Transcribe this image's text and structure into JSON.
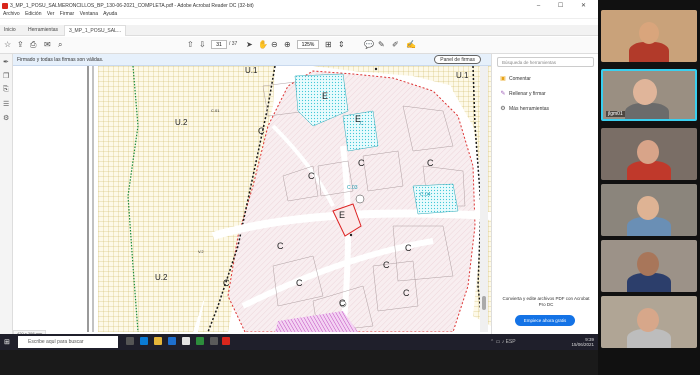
{
  "window": {
    "title": "3_MP_1_POSU_SALMERONCILLOS_BP_130-06-2021_COMPLETA.pdf - Adobe Acrobat Reader DC (32-bit)",
    "menus": [
      "Archivo",
      "Edición",
      "Ver",
      "Firmar",
      "Ventana",
      "Ayuda"
    ],
    "controls": "–  ☐  ✕"
  },
  "tabs": [
    {
      "label": "Inicio"
    },
    {
      "label": "Herramientas"
    },
    {
      "label": "3_MP_1_POSU_SAL..."
    }
  ],
  "toolbar": {
    "page_current": "31",
    "page_total": "/ 37",
    "zoom": "125%"
  },
  "signature_bar": {
    "message": "Firmado y todas las firmas son válidas.",
    "button": "Panel de firmas"
  },
  "right_panel": {
    "search_placeholder": "Búsqueda de herramientas",
    "items": [
      {
        "label": "Comentar",
        "icon": "comment-icon",
        "color": "#e8a317"
      },
      {
        "label": "Rellenar y firmar",
        "icon": "fill-sign-icon",
        "color": "#9b59b6"
      },
      {
        "label": "Más herramientas",
        "icon": "more-tools-icon",
        "color": "#555555"
      }
    ],
    "promo_text": "Convierta y edite archivos PDF con Acrobat Pro DC",
    "promo_button": "Empiece ahora gratis"
  },
  "map": {
    "labels": [
      {
        "text": "U.1",
        "kind": "zone"
      },
      {
        "text": "U.1",
        "kind": "zone"
      },
      {
        "text": "U.2",
        "kind": "zone"
      },
      {
        "text": "U.2",
        "kind": "zone"
      },
      {
        "text": "E",
        "kind": "zone"
      },
      {
        "text": "E",
        "kind": "zone"
      },
      {
        "text": "E",
        "kind": "zone"
      },
      {
        "text": "C",
        "kind": "zone"
      },
      {
        "text": "C",
        "kind": "zone"
      },
      {
        "text": "C",
        "kind": "zone"
      },
      {
        "text": "C",
        "kind": "zone"
      },
      {
        "text": "C",
        "kind": "zone"
      },
      {
        "text": "C",
        "kind": "zone"
      },
      {
        "text": "C",
        "kind": "zone"
      },
      {
        "text": "C",
        "kind": "zone"
      },
      {
        "text": "C",
        "kind": "zone"
      },
      {
        "text": "C",
        "kind": "zone"
      },
      {
        "text": "C",
        "kind": "zone"
      },
      {
        "text": "C",
        "kind": "zone"
      },
      {
        "text": "C.03",
        "kind": "tag"
      },
      {
        "text": "C.04",
        "kind": "tag"
      },
      {
        "text": "C.01",
        "kind": "tag"
      },
      {
        "text": "V.2",
        "kind": "small"
      },
      {
        "text": "V.2",
        "kind": "small"
      }
    ],
    "scale_label": "420 x 398 mm"
  },
  "taskbar": {
    "search_placeholder": "Escribe aquí para buscar",
    "time": "9:39",
    "date": "15/06/2021",
    "lang": "ESP"
  },
  "video_participants": [
    {
      "name": "",
      "bg": "#c9a27a",
      "skin": "#d9a57c",
      "shirt": "#b23a2a"
    },
    {
      "name": "jlgm01",
      "bg": "#9a8f82",
      "skin": "#e0b59a",
      "shirt": "#6b6b6b"
    },
    {
      "name": "",
      "bg": "#7a6e66",
      "skin": "#d8a489",
      "shirt": "#c0392b"
    },
    {
      "name": "",
      "bg": "#8b857c",
      "skin": "#deb394",
      "shirt": "#6a8fb5"
    },
    {
      "name": "",
      "bg": "#9c9288",
      "skin": "#a8765a",
      "shirt": "#2c3e6b"
    },
    {
      "name": "",
      "bg": "#b0a595",
      "skin": "#d7a78a",
      "shirt": "#bdbdbd"
    }
  ]
}
